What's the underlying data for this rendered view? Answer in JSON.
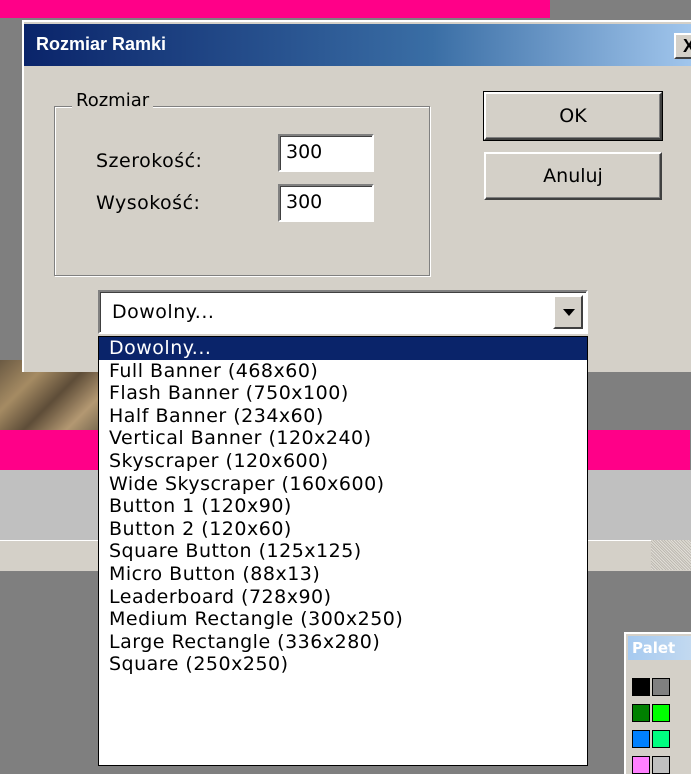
{
  "dialog": {
    "title": "Rozmiar Ramki",
    "close_label": "X",
    "group_label": "Rozmiar",
    "width_label": "Szerokość:",
    "width_value": "300",
    "height_label": "Wysokość:",
    "height_value": "300",
    "ok_label": "OK",
    "cancel_label": "Anuluj",
    "preset_selected": "Dowolny...",
    "preset_options": [
      "Dowolny...",
      "Full Banner (468x60)",
      "Flash Banner (750x100)",
      "Half Banner (234x60)",
      "Vertical Banner (120x240)",
      "Skyscraper (120x600)",
      "Wide Skyscraper (160x600)",
      "Button 1 (120x90)",
      "Button 2 (120x60)",
      "Square Button (125x125)",
      "Micro Button (88x13)",
      "Leaderboard (728x90)",
      "Medium Rectangle (300x250)",
      "Large Rectangle (336x280)",
      "Square (250x250)"
    ]
  },
  "palette": {
    "title": "Palet",
    "swatches": [
      "#000000",
      "#808080",
      "#008000",
      "#00ff00",
      "#0080ff",
      "#00ff80",
      "#ff80ff",
      "#c0c0c0"
    ]
  },
  "colors": {
    "titlebar_start": "#0a246a",
    "titlebar_end": "#a6caf0",
    "selection": "#0a246a",
    "background_pink": "#ff0088"
  }
}
